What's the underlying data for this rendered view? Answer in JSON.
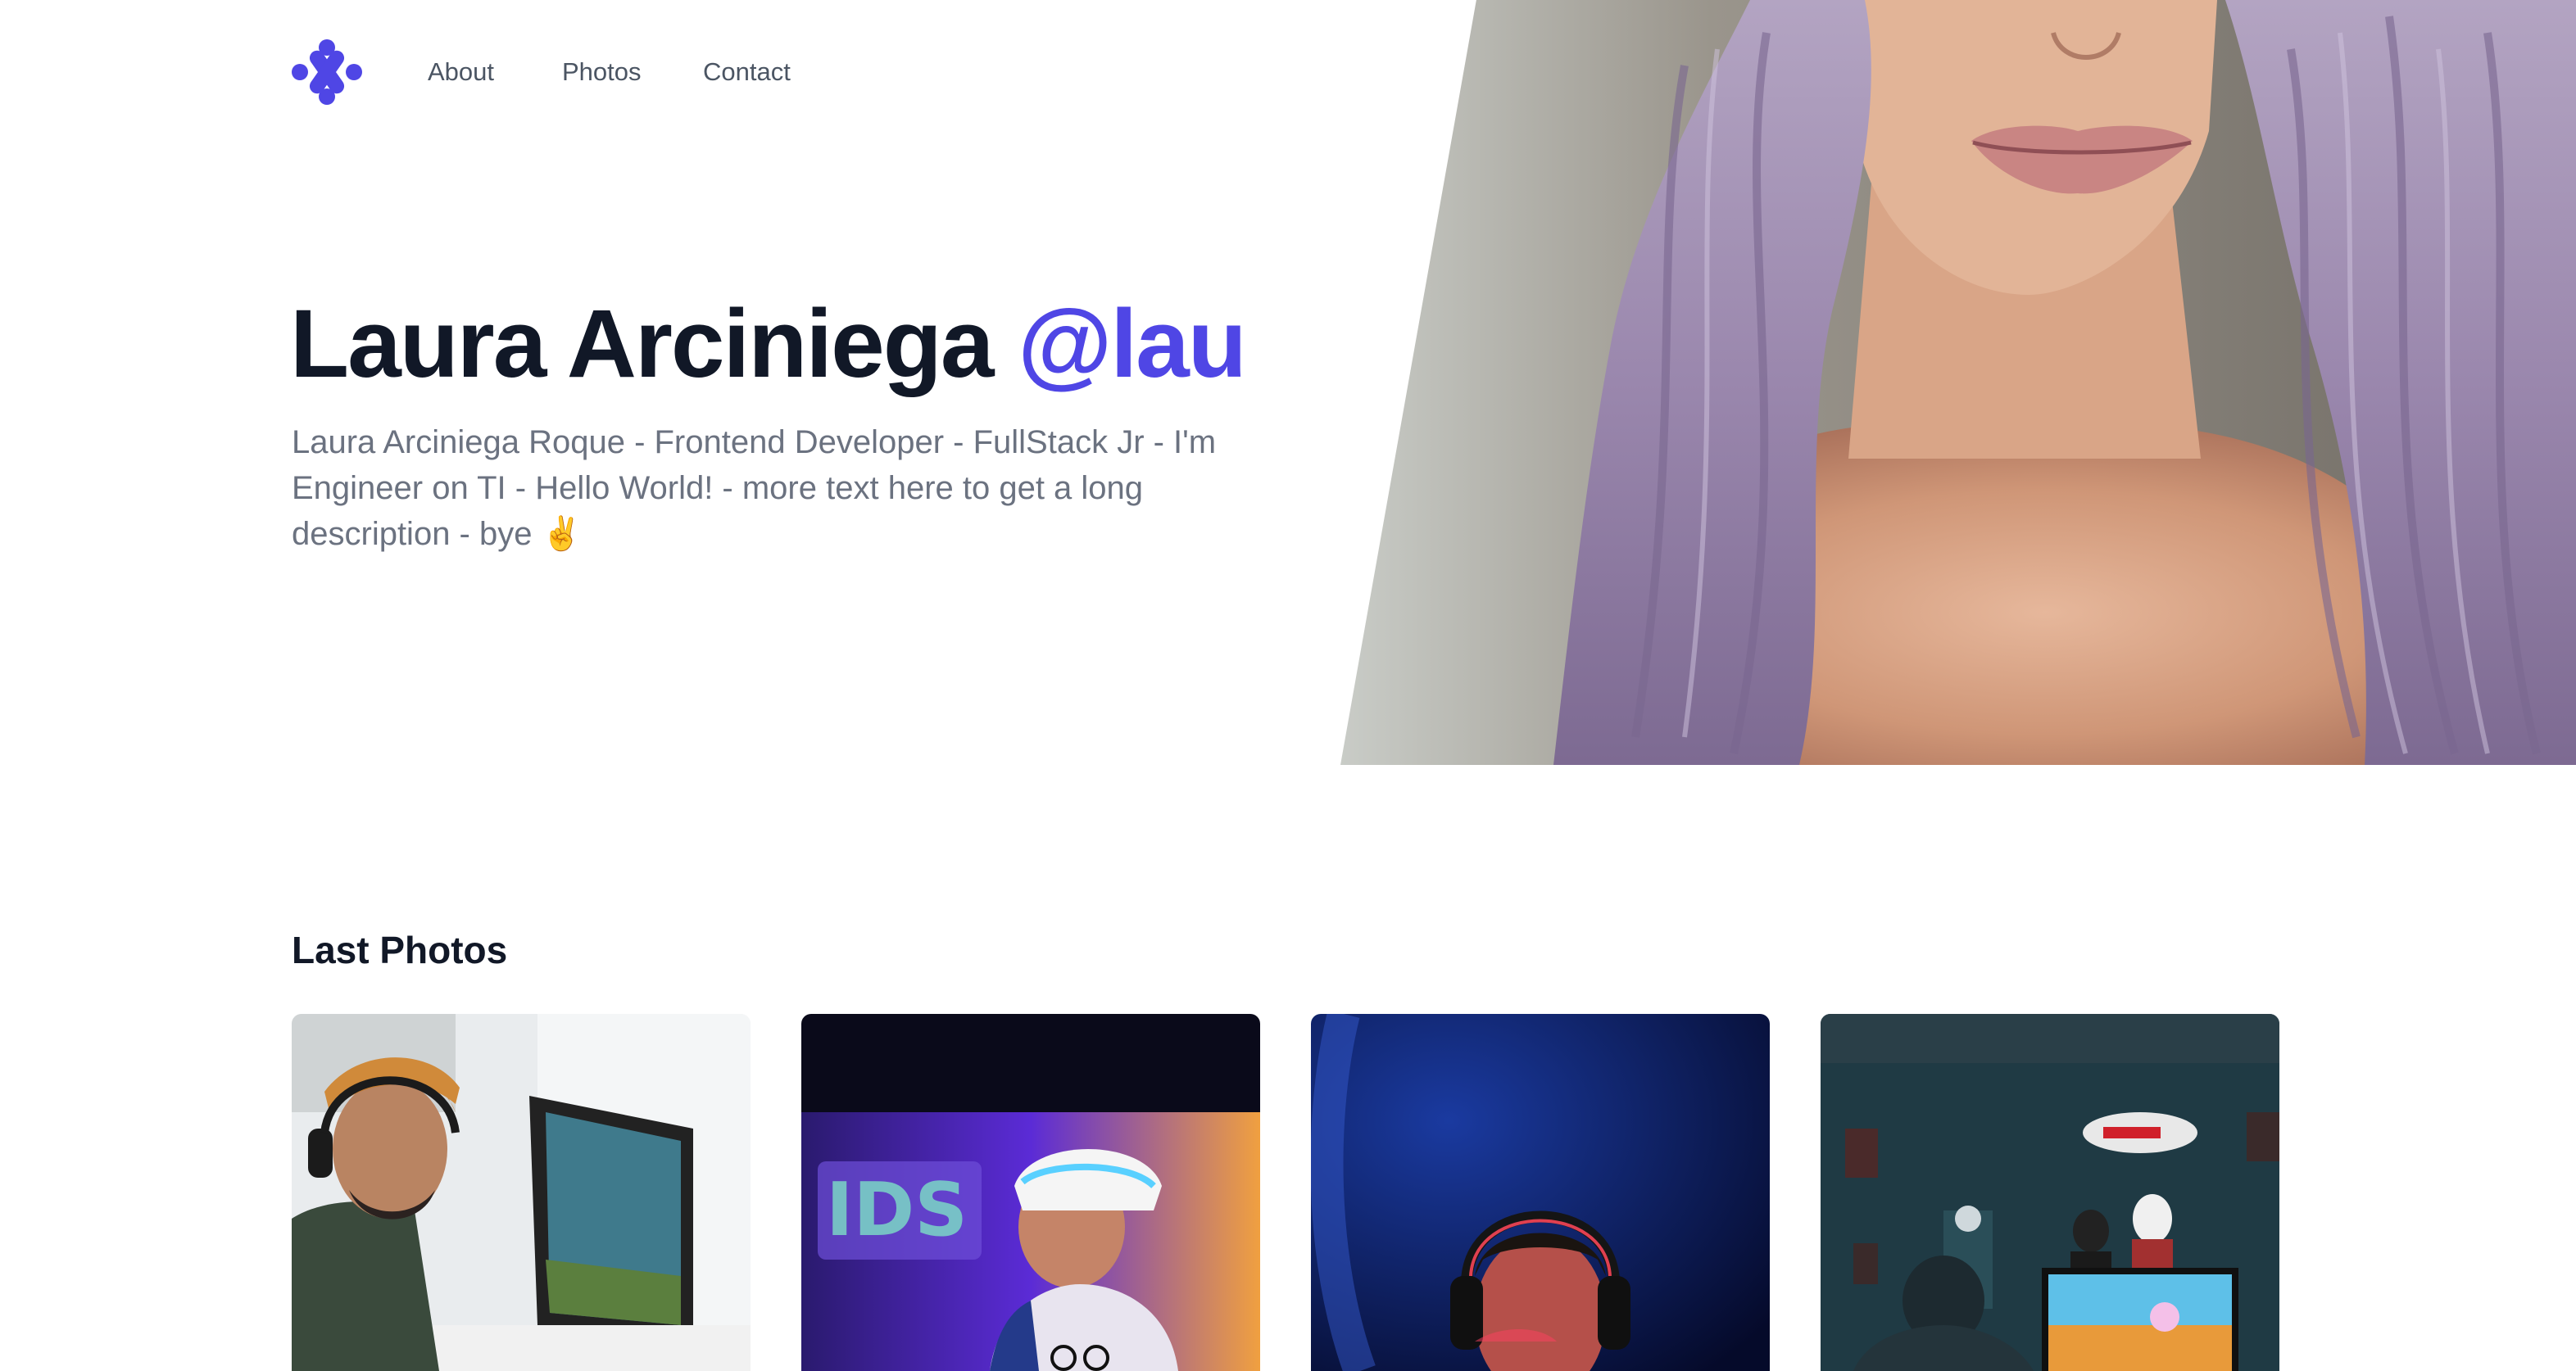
{
  "nav": {
    "about": "About",
    "photos": "Photos",
    "contact": "Contact"
  },
  "hero": {
    "name": "Laura Arciniega",
    "handle": "@lau",
    "description": "Laura Arciniega Roque - Frontend Developer - FullStack Jr - I'm Engineer on TI - Hello World! - more text here to get a long description - bye ✌️"
  },
  "photos_section": {
    "title": "Last Photos"
  },
  "colors": {
    "accent": "#4f46e5",
    "heading": "#111827",
    "body_text": "#6b7280",
    "nav_text": "#4b5563"
  },
  "icons": {
    "logo": "dots-logo-icon"
  }
}
